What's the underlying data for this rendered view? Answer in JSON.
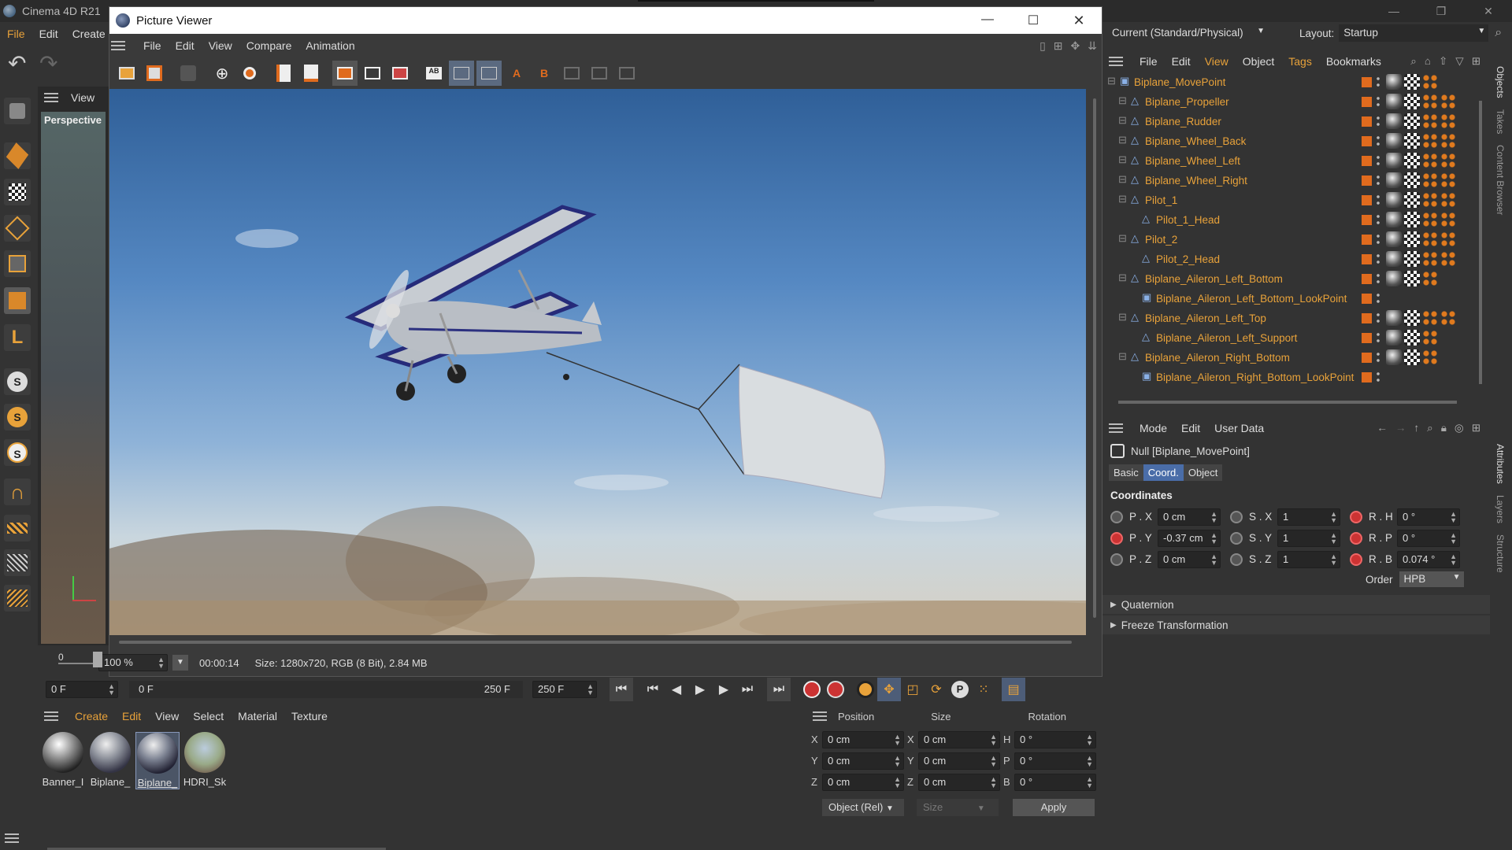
{
  "app": {
    "title": "Cinema 4D R21",
    "menu": [
      "File",
      "Edit",
      "Create"
    ],
    "window_controls": [
      "minimize",
      "maximize",
      "close"
    ]
  },
  "picture_viewer": {
    "title": "Picture Viewer",
    "menu": [
      "File",
      "Edit",
      "View",
      "Compare",
      "Animation"
    ],
    "zoom": "100 %",
    "time": "00:00:14",
    "info": "Size: 1280x720, RGB (8 Bit), 2.84 MB",
    "slider_value": "0"
  },
  "viewport": {
    "menu_label": "View",
    "camera_label": "Perspective"
  },
  "right": {
    "renderer": "Current (Standard/Physical)",
    "layout_label": "Layout:",
    "layout_value": "Startup",
    "obj_menu": [
      "File",
      "Edit",
      "View",
      "Object",
      "Tags",
      "Bookmarks"
    ],
    "side_tabs_top": [
      "Objects",
      "Takes",
      "Content Browser"
    ],
    "side_tabs_bottom": [
      "Attributes",
      "Layers",
      "Structure"
    ],
    "objects": [
      {
        "name": "Biplane_MovePoint",
        "indent": 0,
        "tags": 3
      },
      {
        "name": "Biplane_Propeller",
        "indent": 1,
        "tags": 4
      },
      {
        "name": "Biplane_Rudder",
        "indent": 1,
        "tags": 4
      },
      {
        "name": "Biplane_Wheel_Back",
        "indent": 1,
        "tags": 4
      },
      {
        "name": "Biplane_Wheel_Left",
        "indent": 1,
        "tags": 4
      },
      {
        "name": "Biplane_Wheel_Right",
        "indent": 1,
        "tags": 4
      },
      {
        "name": "Pilot_1",
        "indent": 1,
        "tags": 4
      },
      {
        "name": "Pilot_1_Head",
        "indent": 2,
        "tags": 4
      },
      {
        "name": "Pilot_2",
        "indent": 1,
        "tags": 4
      },
      {
        "name": "Pilot_2_Head",
        "indent": 2,
        "tags": 4
      },
      {
        "name": "Biplane_Aileron_Left_Bottom",
        "indent": 1,
        "tags": 3
      },
      {
        "name": "Biplane_Aileron_Left_Bottom_LookPoint",
        "indent": 2,
        "tags": 0
      },
      {
        "name": "Biplane_Aileron_Left_Top",
        "indent": 1,
        "tags": 4
      },
      {
        "name": "Biplane_Aileron_Left_Support",
        "indent": 2,
        "tags": 3
      },
      {
        "name": "Biplane_Aileron_Right_Bottom",
        "indent": 1,
        "tags": 3
      },
      {
        "name": "Biplane_Aileron_Right_Bottom_LookPoint",
        "indent": 2,
        "tags": 0
      }
    ],
    "attr_menu": [
      "Mode",
      "Edit",
      "User Data"
    ],
    "attr_object": "Null [Biplane_MovePoint]",
    "attr_tabs": [
      "Basic",
      "Coord.",
      "Object"
    ],
    "coords_title": "Coordinates",
    "coords": [
      {
        "p_label": "P . X",
        "p_val": "0 cm",
        "s_label": "S . X",
        "s_val": "1",
        "r_label": "R . H",
        "r_val": "0 °"
      },
      {
        "p_label": "P . Y",
        "p_val": "-0.37 cm",
        "s_label": "S . Y",
        "s_val": "1",
        "r_label": "R . P",
        "r_val": "0 °"
      },
      {
        "p_label": "P . Z",
        "p_val": "0 cm",
        "s_label": "S . Z",
        "s_val": "1",
        "r_label": "R . B",
        "r_val": "0.074 °"
      }
    ],
    "order_label": "Order",
    "order_value": "HPB",
    "sections": [
      "Quaternion",
      "Freeze Transformation"
    ]
  },
  "timeline": {
    "start": "0 F",
    "range_start": "0 F",
    "range_end": "250 F",
    "end": "250 F"
  },
  "materials": {
    "menu": [
      "Create",
      "Edit",
      "View",
      "Select",
      "Material",
      "Texture"
    ],
    "items": [
      "Banner_I",
      "Biplane_",
      "Biplane_",
      "HDRI_Sk"
    ]
  },
  "coord_manager": {
    "headers": [
      "Position",
      "Size",
      "Rotation"
    ],
    "rows": [
      {
        "axis": "X",
        "pos": "0 cm",
        "size_axis": "X",
        "size": "0 cm",
        "rot_axis": "H",
        "rot": "0 °"
      },
      {
        "axis": "Y",
        "pos": "0 cm",
        "size_axis": "Y",
        "size": "0 cm",
        "rot_axis": "P",
        "rot": "0 °"
      },
      {
        "axis": "Z",
        "pos": "0 cm",
        "size_axis": "Z",
        "size": "0 cm",
        "rot_axis": "B",
        "rot": "0 °"
      }
    ],
    "mode": "Object (Rel)",
    "size_mode": "Size",
    "apply": "Apply"
  }
}
